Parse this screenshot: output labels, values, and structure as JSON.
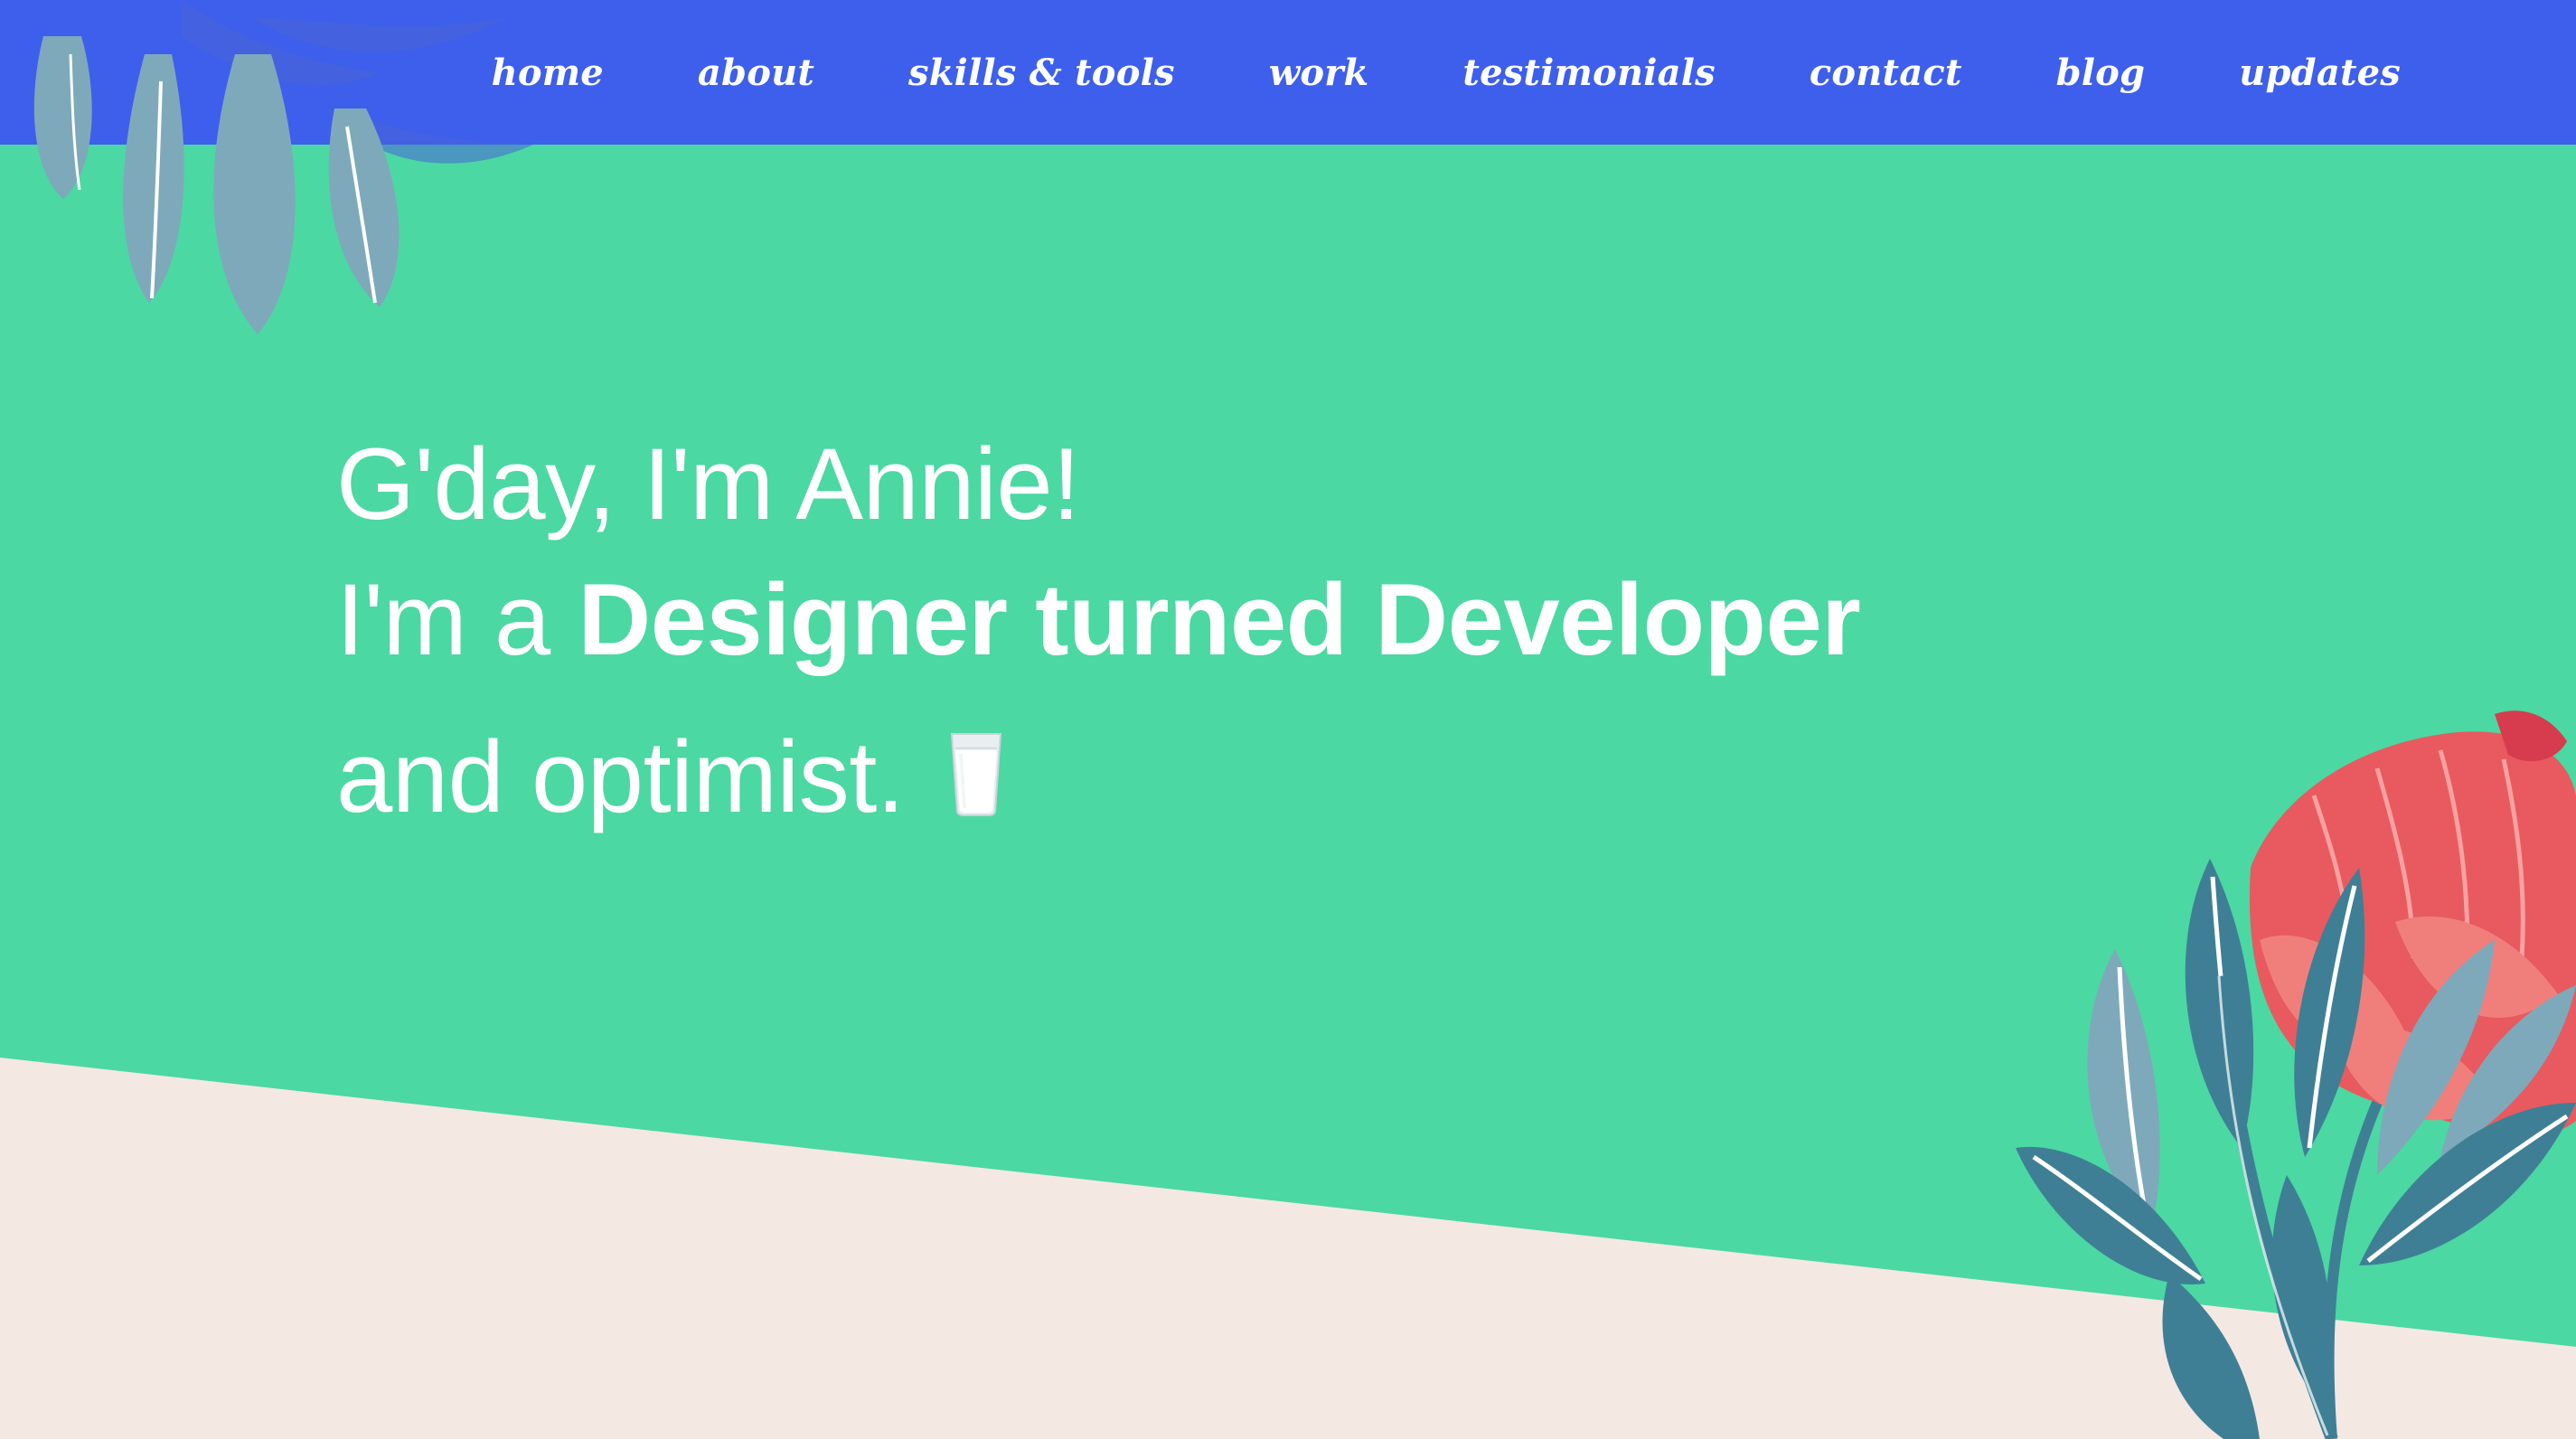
{
  "nav": {
    "links": [
      {
        "label": "home"
      },
      {
        "label": "about"
      },
      {
        "label": "skills & tools"
      },
      {
        "label": "work"
      },
      {
        "label": "testimonials"
      },
      {
        "label": "contact"
      },
      {
        "label": "blog"
      },
      {
        "label": "updates"
      }
    ]
  },
  "hero": {
    "greeting": "G'day, I'm Annie!",
    "intro_prefix": "I'm a ",
    "intro_strong": "Designer turned Developer",
    "tagline": "and optimist.",
    "tagline_icon": "milk-glass-icon"
  },
  "colors": {
    "nav_background": "#3d5fec",
    "hero_background": "#4bd8a3",
    "lower_background": "#f4e8e2",
    "text": "#ffffff",
    "protea_red": "#e85a5f",
    "leaf_teal": "#3f7f95",
    "leaf_grey_blue": "#7ea9ba"
  }
}
